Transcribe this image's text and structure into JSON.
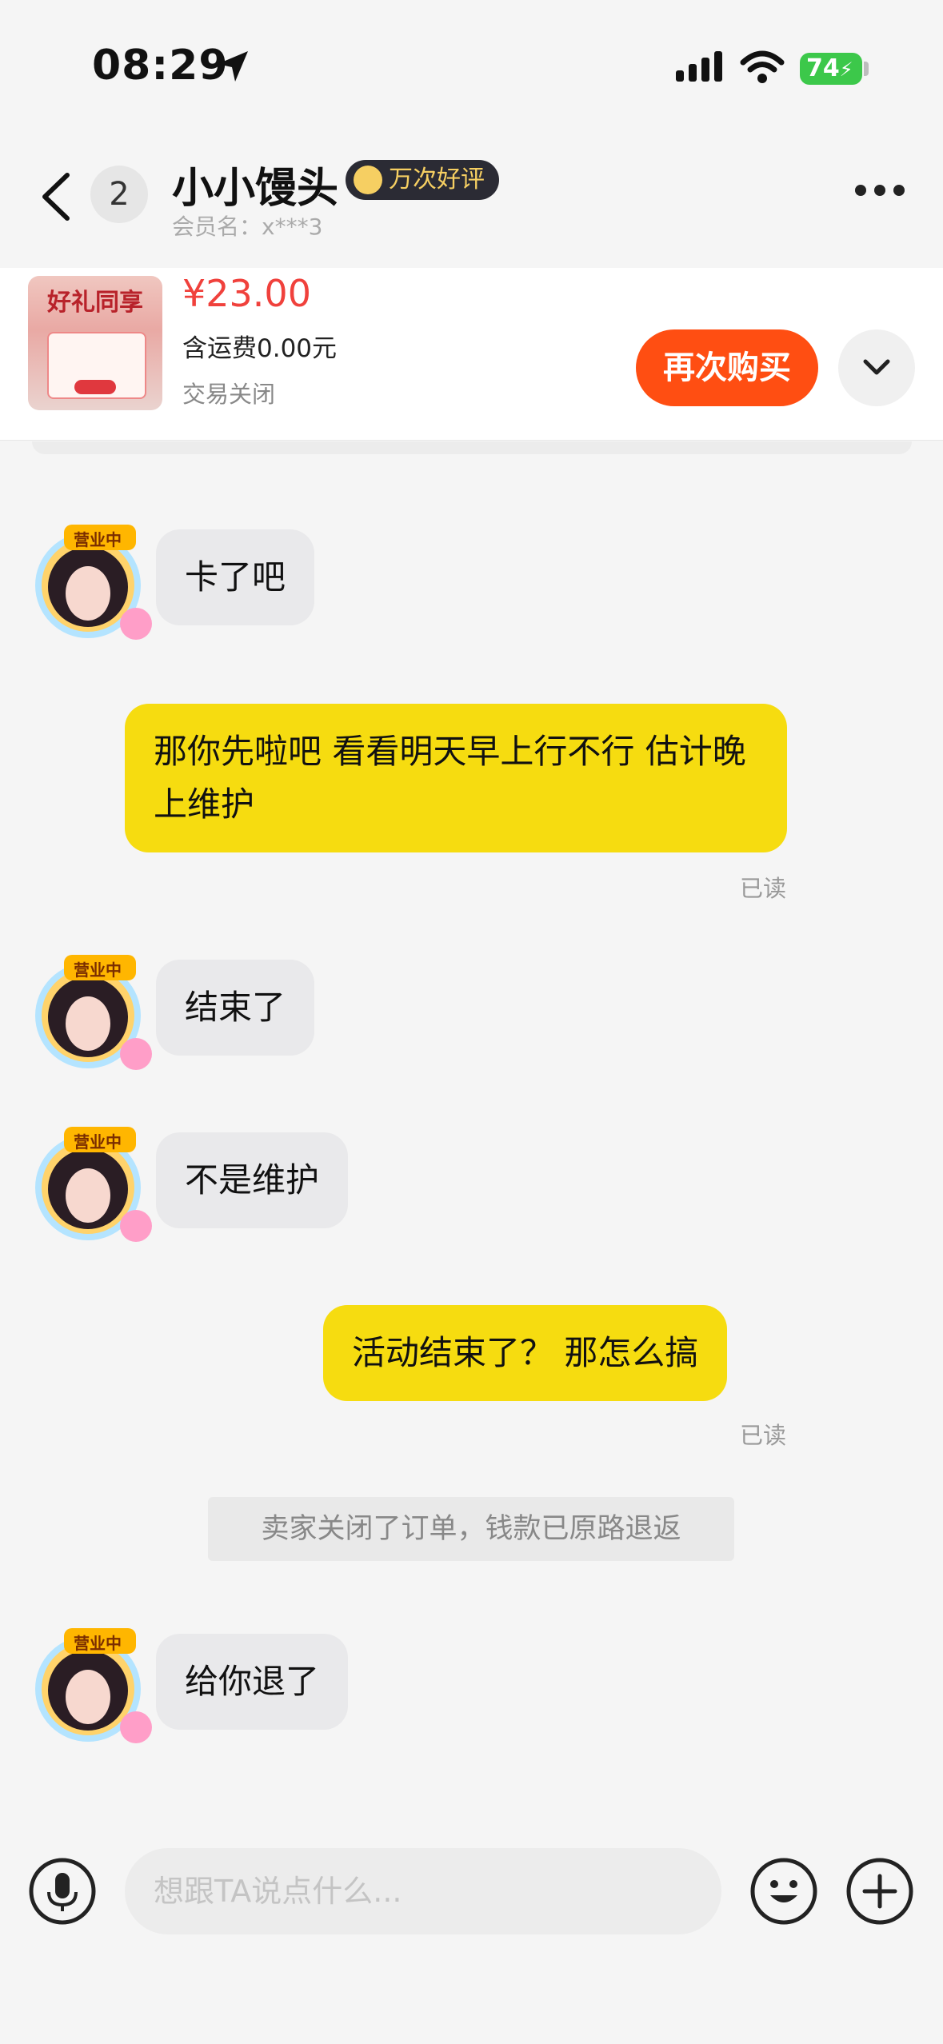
{
  "status_bar": {
    "time": "08:29",
    "battery": "74"
  },
  "header": {
    "unread_count": "2",
    "title": "小小馒头",
    "rating_badge": "万次好评",
    "member_name": "会员名：x***3"
  },
  "product": {
    "thumb_text": "好礼同享",
    "price": "¥23.00",
    "shipping": "含运费0.00元",
    "status": "交易关闭",
    "rebuy_label": "再次购买"
  },
  "messages": [
    {
      "side": "in",
      "text": "卡了吧"
    },
    {
      "side": "out",
      "text": "那你先啦吧 看看明天早上行不行 估计晚上维护",
      "read": "已读"
    },
    {
      "side": "in",
      "text": "结束了"
    },
    {
      "side": "in",
      "text": "不是维护"
    },
    {
      "side": "out",
      "text": "活动结束了？ 那怎么搞",
      "read": "已读"
    },
    {
      "side": "in",
      "text": "给你退了"
    }
  ],
  "system_notice": "卖家关闭了订单，钱款已原路退返",
  "input": {
    "placeholder": "想跟TA说点什么..."
  },
  "avatar_badge": "营业中",
  "colors": {
    "accent": "#ff4e12",
    "price": "#f0413c",
    "outgoing_bubble": "#f6dc10",
    "incoming_bubble": "#e9e9eb"
  }
}
